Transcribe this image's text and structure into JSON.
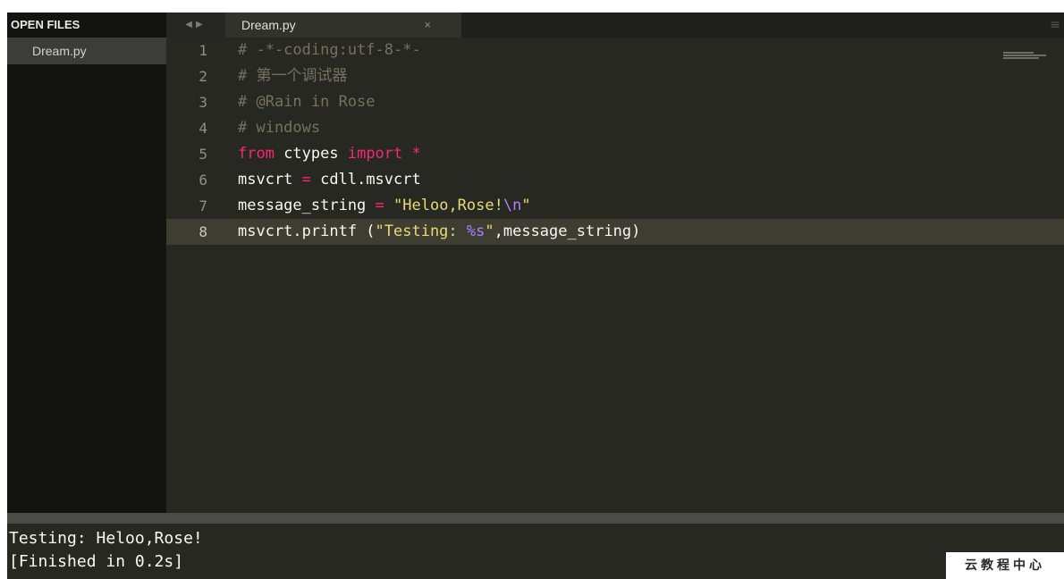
{
  "sidebar": {
    "header": "OPEN FILES",
    "files": [
      "Dream.py"
    ]
  },
  "tabbar": {
    "nav_icons": [
      "left-arrow-icon",
      "right-arrow-icon"
    ],
    "tab": {
      "label": "Dream.py",
      "close_glyph": "×"
    },
    "menu_glyph": "≡"
  },
  "editor": {
    "language": "python",
    "active_line": 8,
    "line_numbers": [
      "1",
      "2",
      "3",
      "4",
      "5",
      "6",
      "7",
      "8"
    ],
    "lines": [
      "# -*-coding:utf-8-*-",
      "# 第一个调试器",
      "# @Rain in Rose",
      "# windows",
      "from ctypes import *",
      "msvcrt = cdll.msvcrt",
      "message_string = \"Heloo,Rose!\\n\"",
      "msvcrt.printf (\"Testing: %s\",message_string)"
    ]
  },
  "console": {
    "lines": [
      "Testing: Heloo,Rose!",
      "[Finished in 0.2s]"
    ]
  },
  "watermark": "云教程中心",
  "colors": {
    "background": "#272822",
    "sidebar": "#131410",
    "comment": "#75715e",
    "keyword": "#f92672",
    "string": "#e6db74",
    "escape": "#ae81ff",
    "text": "#f8f8f2"
  }
}
